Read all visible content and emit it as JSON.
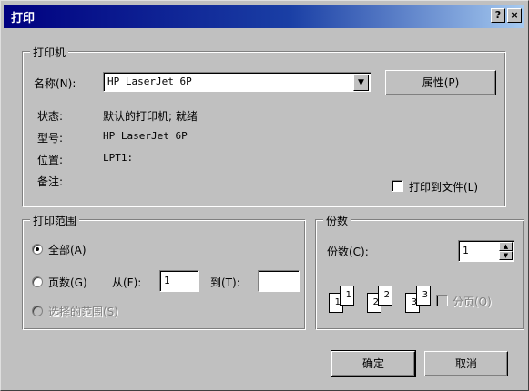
{
  "window": {
    "title": "打印",
    "help_button": "?",
    "close_button": "×"
  },
  "printer": {
    "group_title": "打印机",
    "name_label": "名称(N):",
    "name_value": "HP LaserJet 6P",
    "properties_button": "属性(P)",
    "status_label": "状态:",
    "status_value": "默认的打印机; 就绪",
    "type_label": "型号:",
    "type_value": "HP LaserJet 6P",
    "where_label": "位置:",
    "where_value": "LPT1:",
    "comment_label": "备注:",
    "comment_value": "",
    "print_to_file_label": "打印到文件(L)"
  },
  "range": {
    "group_title": "打印范围",
    "all_label": "全部(A)",
    "pages_label": "页数(G)",
    "from_label": "从(F):",
    "from_value": "1",
    "to_label": "到(T):",
    "to_value": "",
    "selection_label": "选择的范围(S)"
  },
  "copies": {
    "group_title": "份数",
    "number_label": "份数(C):",
    "number_value": "1",
    "collate_label": "分页(O)",
    "collate_pages": [
      "1",
      "1",
      "2",
      "2",
      "3",
      "3"
    ]
  },
  "actions": {
    "ok_label": "确定",
    "cancel_label": "取消"
  }
}
